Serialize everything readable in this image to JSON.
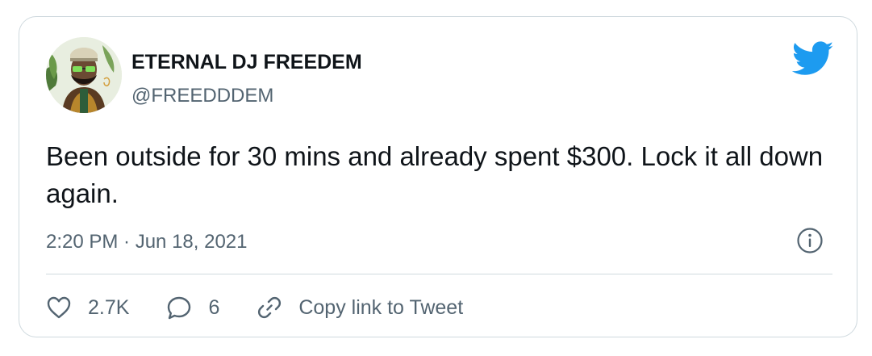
{
  "tweet": {
    "author": {
      "display_name": "ETERNAL DJ FREEDEM",
      "handle": "@FREEDDDEM",
      "avatar_icon": "avatar-portrait"
    },
    "brand_icon": "twitter-bird-icon",
    "text": "Been outside for 30 mins and already spent $300. Lock it all down again.",
    "timestamp": "2:20 PM · Jun 18, 2021",
    "info_icon": "info-icon",
    "actions": {
      "like_count": "2.7K",
      "reply_count": "6",
      "copy_link_label": "Copy link to Tweet"
    },
    "colors": {
      "brand_blue": "#1d9bf0",
      "text_primary": "#0f1419",
      "text_secondary": "#536471",
      "border": "#cfd9de"
    }
  }
}
